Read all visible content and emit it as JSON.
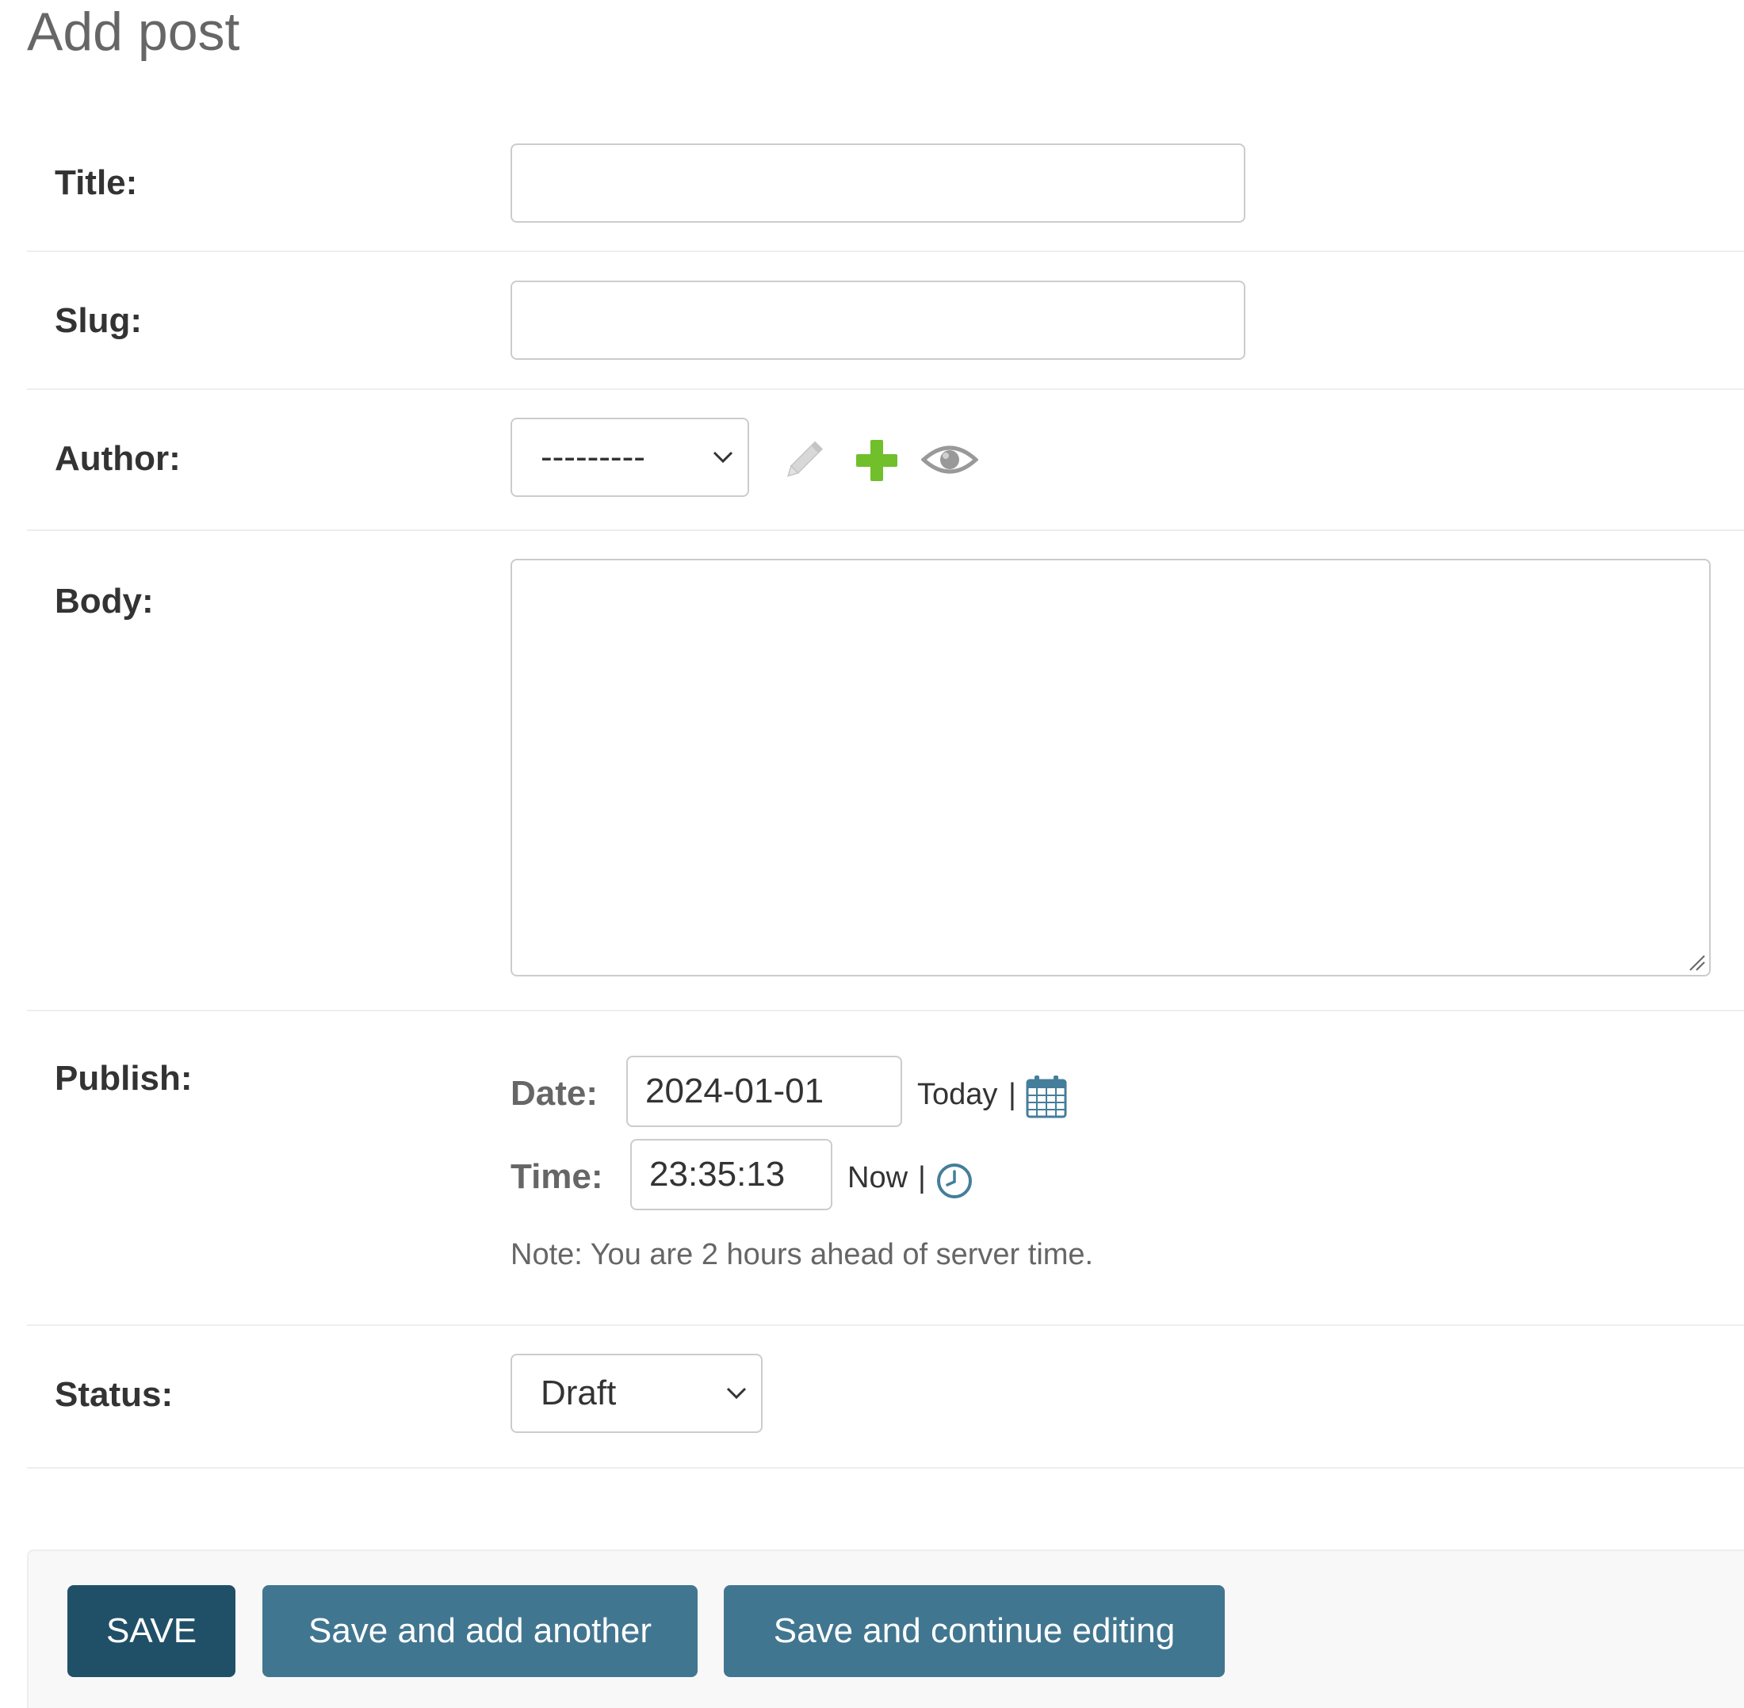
{
  "page": {
    "title": "Add post"
  },
  "form": {
    "title": {
      "label": "Title:",
      "value": ""
    },
    "slug": {
      "label": "Slug:",
      "value": ""
    },
    "author": {
      "label": "Author:",
      "selected": "---------"
    },
    "body": {
      "label": "Body:",
      "value": ""
    },
    "publish": {
      "label": "Publish:",
      "date_label": "Date:",
      "date_value": "2024-01-01",
      "today_link": "Today",
      "time_label": "Time:",
      "time_value": "23:35:13",
      "now_link": "Now",
      "separator": "|",
      "note": "Note: You are 2 hours ahead of server time."
    },
    "status": {
      "label": "Status:",
      "selected": "Draft"
    }
  },
  "actions": {
    "save": "SAVE",
    "save_add_another": "Save and add another",
    "save_continue": "Save and continue editing"
  },
  "colors": {
    "primary_button": "#205067",
    "secondary_button": "#417690",
    "add_icon": "#70bf2b",
    "calendar_icon": "#447e9b"
  },
  "icons": {
    "edit": "pencil-icon",
    "add": "plus-icon",
    "view": "eye-icon",
    "calendar": "calendar-icon",
    "clock": "clock-icon"
  }
}
